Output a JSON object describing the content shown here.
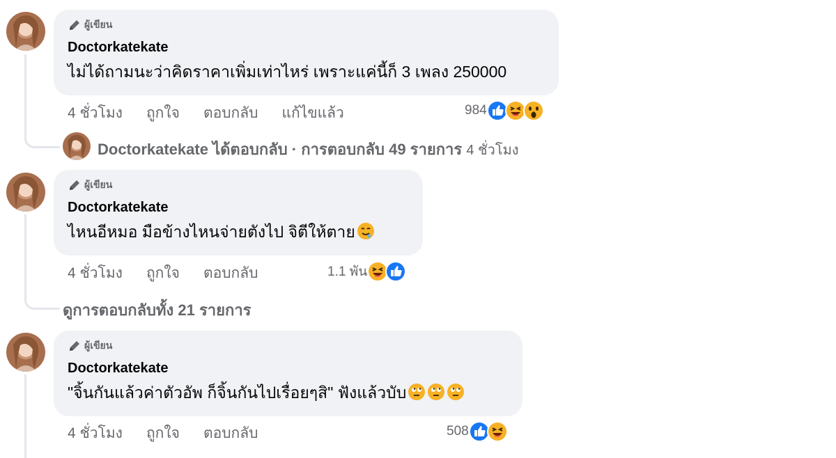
{
  "author_badge_label": "ผู้เขียน",
  "comments": [
    {
      "author": "Doctorkatekate",
      "text": "ไม่ได้ถามนะว่าคิดราคาเพิ่มเท่าไหร่ เพราะแค่นี้ก็ 3 เพลง 250000",
      "time": "4 ชั่วโมง",
      "like": "ถูกใจ",
      "reply": "ตอบกลับ",
      "edited": "แก้ไขแล้ว",
      "reaction_count": "984",
      "reactions": [
        "like-icon",
        "haha-icon",
        "wow-icon"
      ],
      "replies_summary": {
        "author": "Doctorkatekate",
        "replied": "ได้ตอบกลับ",
        "separator": "·",
        "count_text": "การตอบกลับ 49 รายการ",
        "time": "4 ชั่วโมง"
      }
    },
    {
      "author": "Doctorkatekate",
      "text": "ไหนอีหมอ มือข้างไหนจ่ายตังไป จิตีให้ตาย",
      "text_emojis": [
        "drooling-face-icon"
      ],
      "time": "4 ชั่วโมง",
      "like": "ถูกใจ",
      "reply": "ตอบกลับ",
      "reaction_count": "1.1 พัน",
      "reactions": [
        "haha-icon",
        "like-icon"
      ],
      "view_replies": "ดูการตอบกลับทั้ง 21 รายการ"
    },
    {
      "author": "Doctorkatekate",
      "text": "\"จิ้นกันแล้วค่าตัวอัพ ก็จิ้นกันไปเรื่อยๆสิ\" ฟังแล้วบับ",
      "text_emojis": [
        "rolling-eyes-icon",
        "rolling-eyes-icon",
        "rolling-eyes-icon"
      ],
      "time": "4 ชั่วโมง",
      "like": "ถูกใจ",
      "reply": "ตอบกลับ",
      "reaction_count": "508",
      "reactions": [
        "like-icon",
        "haha-icon"
      ]
    }
  ],
  "colors": {
    "like": "#1877f2",
    "bubble": "#f0f2f5",
    "meta": "#65676b",
    "emoji": "#f7b125"
  }
}
